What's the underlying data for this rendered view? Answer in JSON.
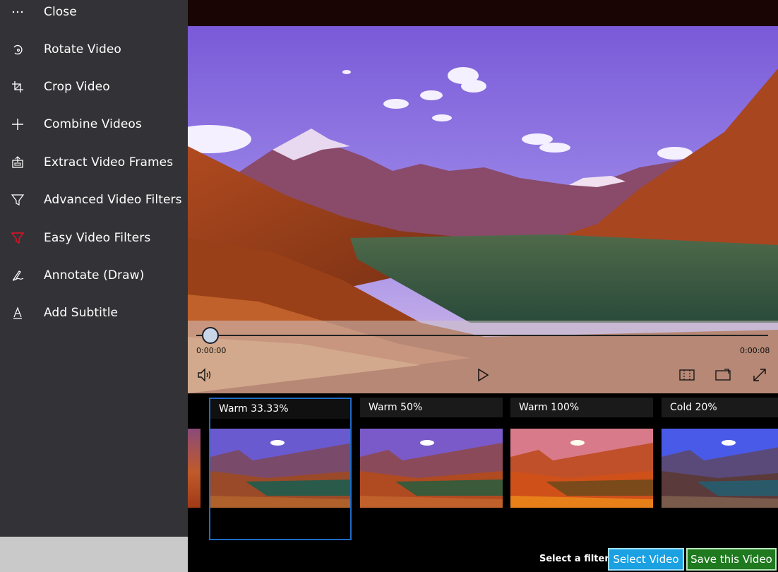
{
  "sidebar": {
    "items": [
      {
        "label": "Close",
        "icon": "more-dots-icon"
      },
      {
        "label": "Rotate Video",
        "icon": "rotate-icon"
      },
      {
        "label": "Crop Video",
        "icon": "crop-icon"
      },
      {
        "label": "Combine Videos",
        "icon": "plus-icon"
      },
      {
        "label": "Extract Video Frames",
        "icon": "extract-frames-icon"
      },
      {
        "label": "Advanced Video Filters",
        "icon": "filter-icon"
      },
      {
        "label": "Easy Video Filters",
        "icon": "filter-icon-active"
      },
      {
        "label": "Annotate (Draw)",
        "icon": "pen-icon"
      },
      {
        "label": "Add Subtitle",
        "icon": "text-icon"
      }
    ],
    "active_icon_color": "#e81123"
  },
  "player": {
    "current_time": "0:00:00",
    "total_time": "0:00:08",
    "progress": 0.02
  },
  "filters": {
    "items": [
      {
        "label": "Warm 33.33%",
        "selected": true,
        "tint": "warm-light"
      },
      {
        "label": "Warm 50%",
        "selected": false,
        "tint": "warm-medium"
      },
      {
        "label": "Warm 100%",
        "selected": false,
        "tint": "warm-strong"
      },
      {
        "label": "Cold 20%",
        "selected": false,
        "tint": "cold"
      }
    ]
  },
  "actions": {
    "hint": "Select a filter!",
    "select_label": "Select Video",
    "save_label": "Save this Video"
  },
  "colors": {
    "selected_border": "#1f6bc7",
    "select_button": "#1ba1e2",
    "save_button": "#1f7a1f"
  }
}
